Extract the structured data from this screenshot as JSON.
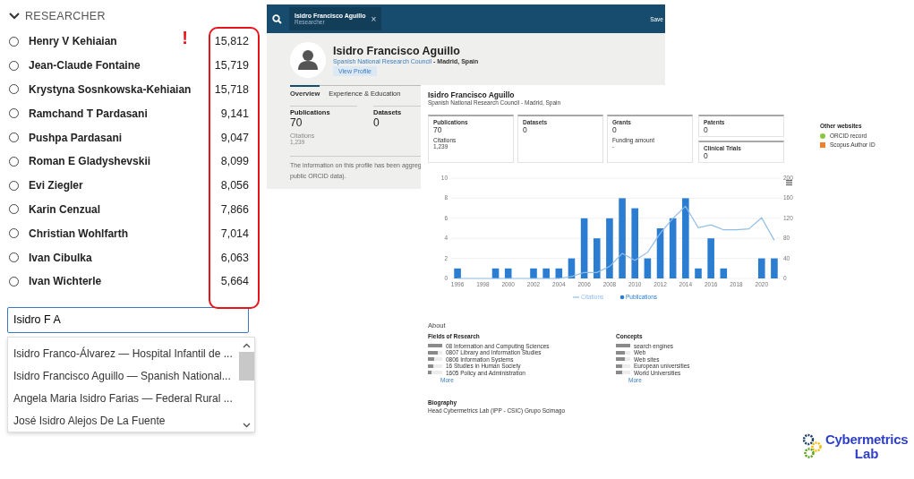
{
  "researcher_panel": {
    "header": "RESEARCHER",
    "expanded": true,
    "alert_mark": "!",
    "items": [
      {
        "name": "Henry V Kehiaian",
        "count": "15,812",
        "selected": false
      },
      {
        "name": "Jean-Claude Fontaine",
        "count": "15,719",
        "selected": false
      },
      {
        "name": "Krystyna Sosnkowska-Kehiaian",
        "count": "15,718",
        "selected": false
      },
      {
        "name": "Ramchand T Pardasani",
        "count": "9,141",
        "selected": false
      },
      {
        "name": "Pushpa Pardasani",
        "count": "9,047",
        "selected": false
      },
      {
        "name": "Roman E Gladyshevskii",
        "count": "8,099",
        "selected": false
      },
      {
        "name": "Evi Ziegler",
        "count": "8,056",
        "selected": false
      },
      {
        "name": "Karin Cenzual",
        "count": "7,866",
        "selected": false
      },
      {
        "name": "Christian Wohlfarth",
        "count": "7,014",
        "selected": false
      },
      {
        "name": "Ivan Cibulka",
        "count": "6,063",
        "selected": false
      },
      {
        "name": "Ivan Wichterle",
        "count": "5,664",
        "selected": false
      }
    ],
    "search": {
      "value": "Isidro F A"
    },
    "suggestions": [
      "Isidro Franco-Álvarez — Hospital Infantil de ...",
      "Isidro Francisco Aguillo — Spanish National...",
      "Angela Maria Isidro Farias — Federal Rural ...",
      "José Isidro Alejos De La Fuente"
    ]
  },
  "profile_window": {
    "search_chip": {
      "title": "Isidro Francisco Aguillo",
      "subtitle": "Researcher",
      "close": "×"
    },
    "toolbar_action": "Save",
    "name": "Isidro Francisco Aguillo",
    "institution": "Spanish National Research Council",
    "location": " - Madrid, Spain",
    "view_button": "View Profile",
    "tabs": [
      {
        "label": "Overview",
        "selected": true
      },
      {
        "label": "Experience & Education",
        "selected": false
      }
    ],
    "stats": [
      {
        "label": "Publications",
        "value": "70",
        "sub_label": "Citations",
        "sub_value": "1,239"
      },
      {
        "label": "Datasets",
        "value": "0"
      }
    ],
    "notice_lines": [
      "The information on this profile has been aggreg",
      "public ORCID data)."
    ]
  },
  "dashboard": {
    "name": "Isidro Francisco Aguillo",
    "affiliation": "Spanish National Research Council - Madrid, Spain",
    "cards": [
      {
        "label": "Publications",
        "value": "70",
        "sub_label": "Citations",
        "sub_value": "1,239"
      },
      {
        "label": "Datasets",
        "value": "0"
      },
      {
        "label": "Grants",
        "value": "0",
        "sub_label": "Funding amount",
        "sub_value": "-"
      },
      {
        "label": "Patents",
        "value": "0"
      },
      {
        "label": "Clinical Trials",
        "value": "0"
      }
    ],
    "other_websites": {
      "title": "Other websites",
      "links": [
        {
          "label": "ORCID record",
          "color": "#8cc63f",
          "kind": "dot"
        },
        {
          "label": "Scopus Author ID",
          "color": "#f07f2e",
          "kind": "square"
        }
      ]
    },
    "chart_data": {
      "type": "bar",
      "x": [
        1996,
        1997,
        1998,
        1999,
        2000,
        2001,
        2002,
        2003,
        2004,
        2005,
        2006,
        2007,
        2008,
        2009,
        2010,
        2011,
        2012,
        2013,
        2014,
        2015,
        2016,
        2017,
        2018,
        2019,
        2020,
        2021
      ],
      "grid": true,
      "xlim": [
        1995.5,
        2021.5
      ],
      "series": [
        {
          "name": "Citations",
          "color": "#90bde8",
          "type": "line",
          "axis": "y2",
          "values": [
            0,
            0,
            0,
            0,
            0,
            0,
            0,
            0,
            0,
            4,
            12,
            12,
            24,
            50,
            36,
            52,
            90,
            120,
            144,
            101,
            107,
            97,
            97,
            99,
            121,
            76
          ]
        },
        {
          "name": "Publications",
          "color": "#2a7dd1",
          "type": "bar",
          "values": [
            1,
            0,
            0,
            1,
            1,
            0,
            1,
            1,
            1,
            2,
            6,
            4,
            6,
            8,
            7,
            2,
            5,
            6,
            8,
            1,
            4,
            1,
            0,
            0,
            2,
            2
          ]
        }
      ],
      "xticks": [
        1996,
        1998,
        2000,
        2002,
        2004,
        2006,
        2008,
        2010,
        2012,
        2014,
        2016,
        2018,
        2020
      ],
      "ylim": [
        0,
        10
      ],
      "yticks": [
        0,
        2,
        4,
        6,
        8,
        10
      ],
      "y2lim": [
        0,
        200
      ],
      "y2ticks": [
        0,
        40,
        80,
        120,
        160,
        200
      ]
    },
    "about": {
      "title": "About",
      "fields_title": "Fields of Research",
      "fields": [
        {
          "label": "08 Information and Computing Sciences",
          "level": 1
        },
        {
          "label": "0807 Library and Information Studies",
          "level": 0.7
        },
        {
          "label": "0806 Information Systems",
          "level": 0.45
        },
        {
          "label": "16 Studies in Human Society",
          "level": 0.35
        },
        {
          "label": "1605 Policy and Administration",
          "level": 0.25
        }
      ],
      "fields_more": "More",
      "concepts_title": "Concepts",
      "concepts": [
        {
          "label": "search engines",
          "level": 1
        },
        {
          "label": "Web",
          "level": 0.65
        },
        {
          "label": "Web sites",
          "level": 0.65
        },
        {
          "label": "European universities",
          "level": 0.45
        },
        {
          "label": "World Universities",
          "level": 0.45
        }
      ],
      "concepts_more": "More",
      "biography_title": "Biography",
      "biography": "Head Cybermetrics Lab (IPP - CSIC) Grupo Scimago"
    }
  },
  "logo": {
    "line1": "Cybermetrics",
    "line2": "Lab"
  }
}
